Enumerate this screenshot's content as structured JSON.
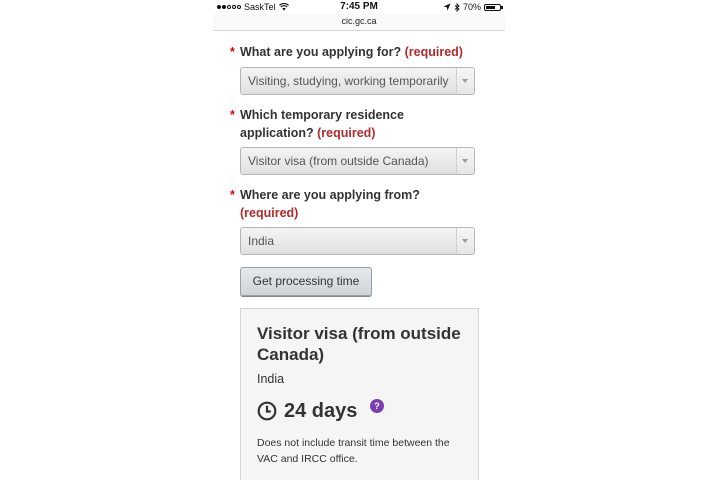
{
  "status_bar": {
    "carrier": "SaskTel",
    "time": "7:45 PM",
    "battery": "70%",
    "battery_level": 0.7,
    "signal_dots_filled": 2,
    "signal_dots_total": 5
  },
  "browser": {
    "url": "cic.gc.ca"
  },
  "form": {
    "required_marker": "*",
    "required_text": "(required)",
    "q1": {
      "label": "What are you applying for?",
      "value": "Visiting, studying, working temporarily"
    },
    "q2": {
      "label": "Which temporary residence application?",
      "value": "Visitor visa (from outside Canada)"
    },
    "q3": {
      "label": "Where are you applying from?",
      "value": "India"
    },
    "submit_label": "Get processing time"
  },
  "result": {
    "title": "Visitor visa (from outside Canada)",
    "country": "India",
    "processing_time": "24 days",
    "help_symbol": "?",
    "note": "Does not include transit time between the VAC and IRCC office."
  },
  "colors": {
    "required": "#b32b2b",
    "asterisk": "#d3080c",
    "help_badge": "#7a3eb0"
  }
}
